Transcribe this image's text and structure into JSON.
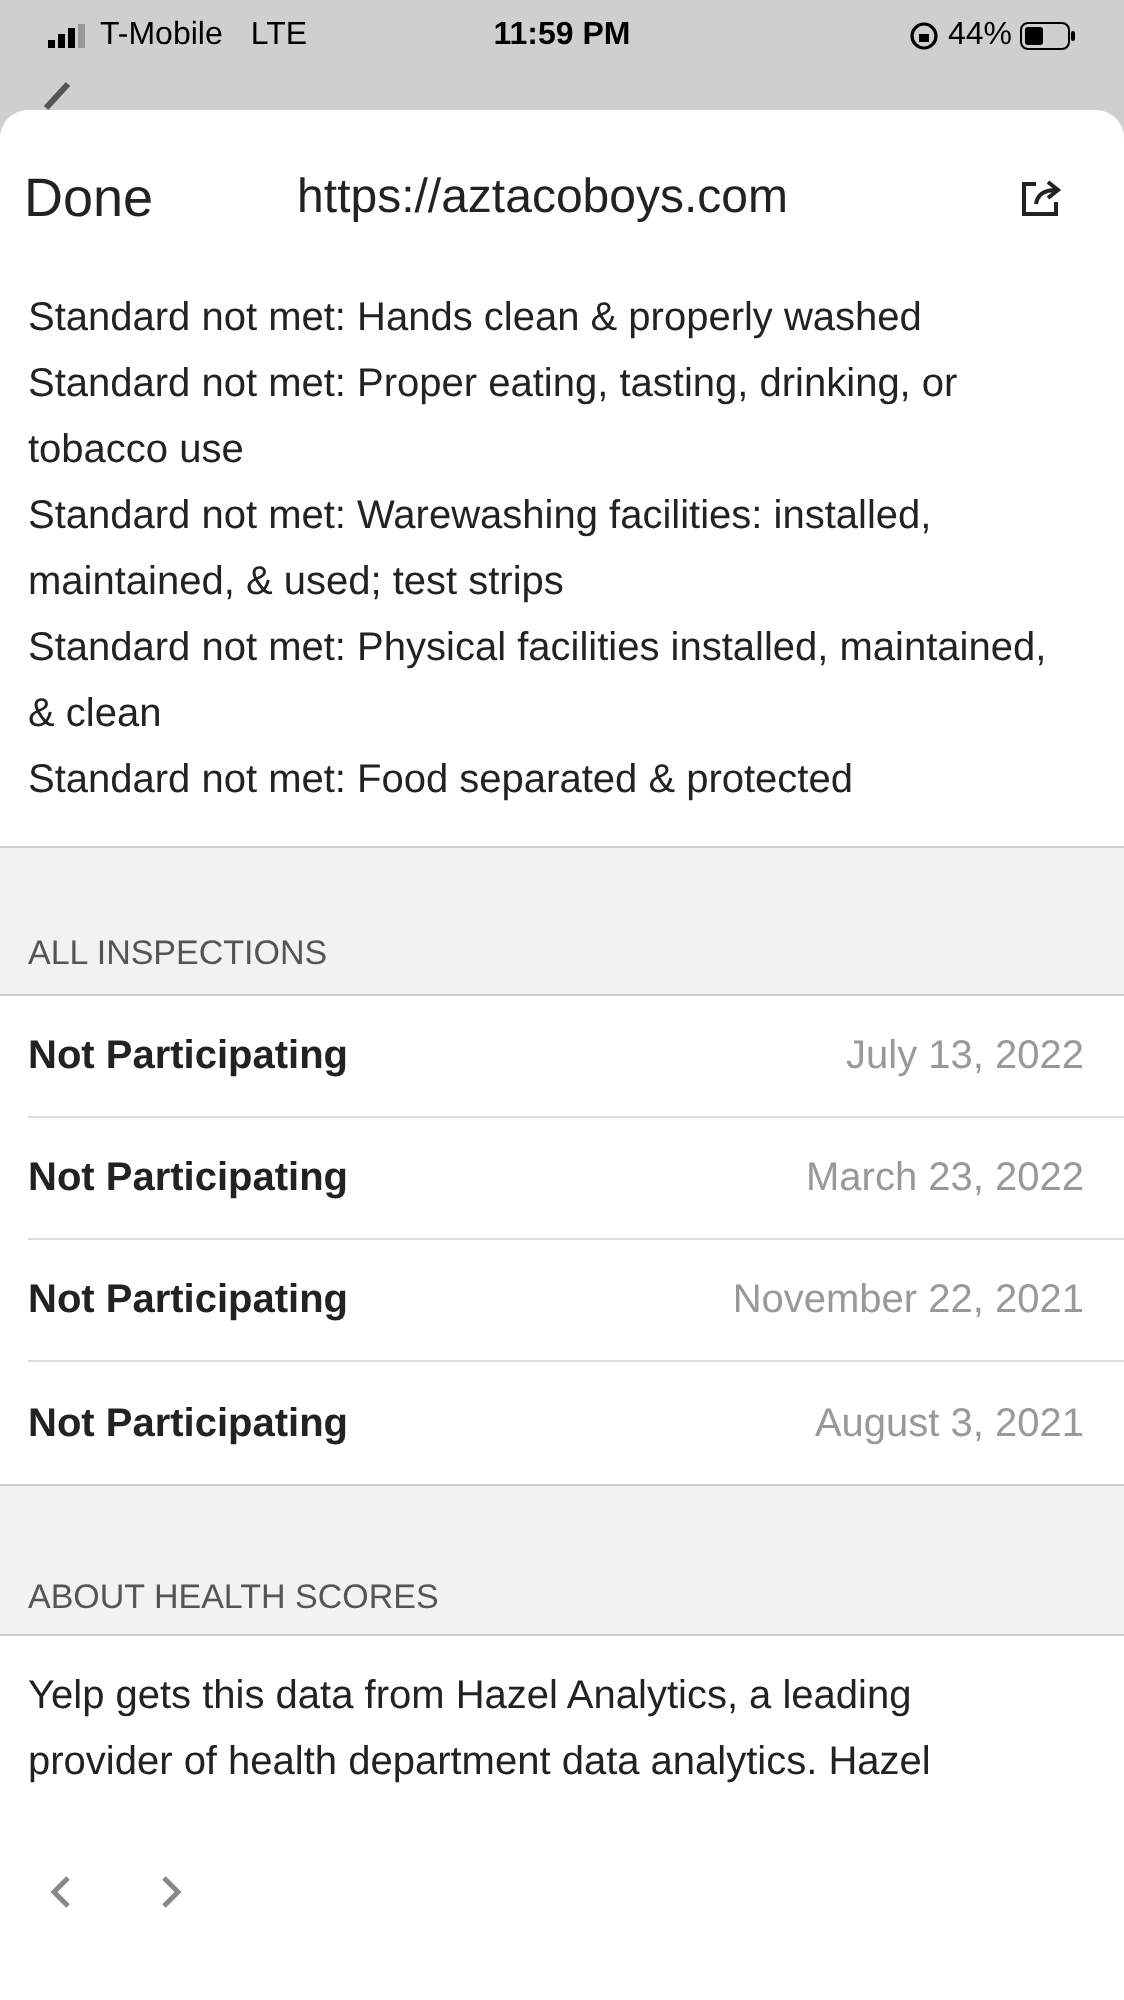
{
  "status_bar": {
    "carrier": "T-Mobile",
    "network": "LTE",
    "time": "11:59 PM",
    "battery": "44%"
  },
  "browser": {
    "done": "Done",
    "url": "https://aztacoboys.com"
  },
  "violations": [
    "Standard not met: Hands clean & properly washed",
    "Standard not met: Proper eating, tasting, drinking, or tobacco use",
    "Standard not met: Warewashing facilities: installed, maintained, & used; test strips",
    "Standard not met: Physical facilities installed, maintained, & clean",
    "Standard not met: Food separated & protected"
  ],
  "inspections": {
    "header": "ALL INSPECTIONS",
    "rows": [
      {
        "status": "Not Participating",
        "date": "July 13, 2022"
      },
      {
        "status": "Not Participating",
        "date": "March 23, 2022"
      },
      {
        "status": "Not Participating",
        "date": "November 22, 2021"
      },
      {
        "status": "Not Participating",
        "date": "August 3, 2021"
      }
    ]
  },
  "about": {
    "header": "ABOUT HEALTH SCORES",
    "text": "Yelp gets this data from Hazel Analytics, a leading provider of health department data analytics. Hazel"
  }
}
